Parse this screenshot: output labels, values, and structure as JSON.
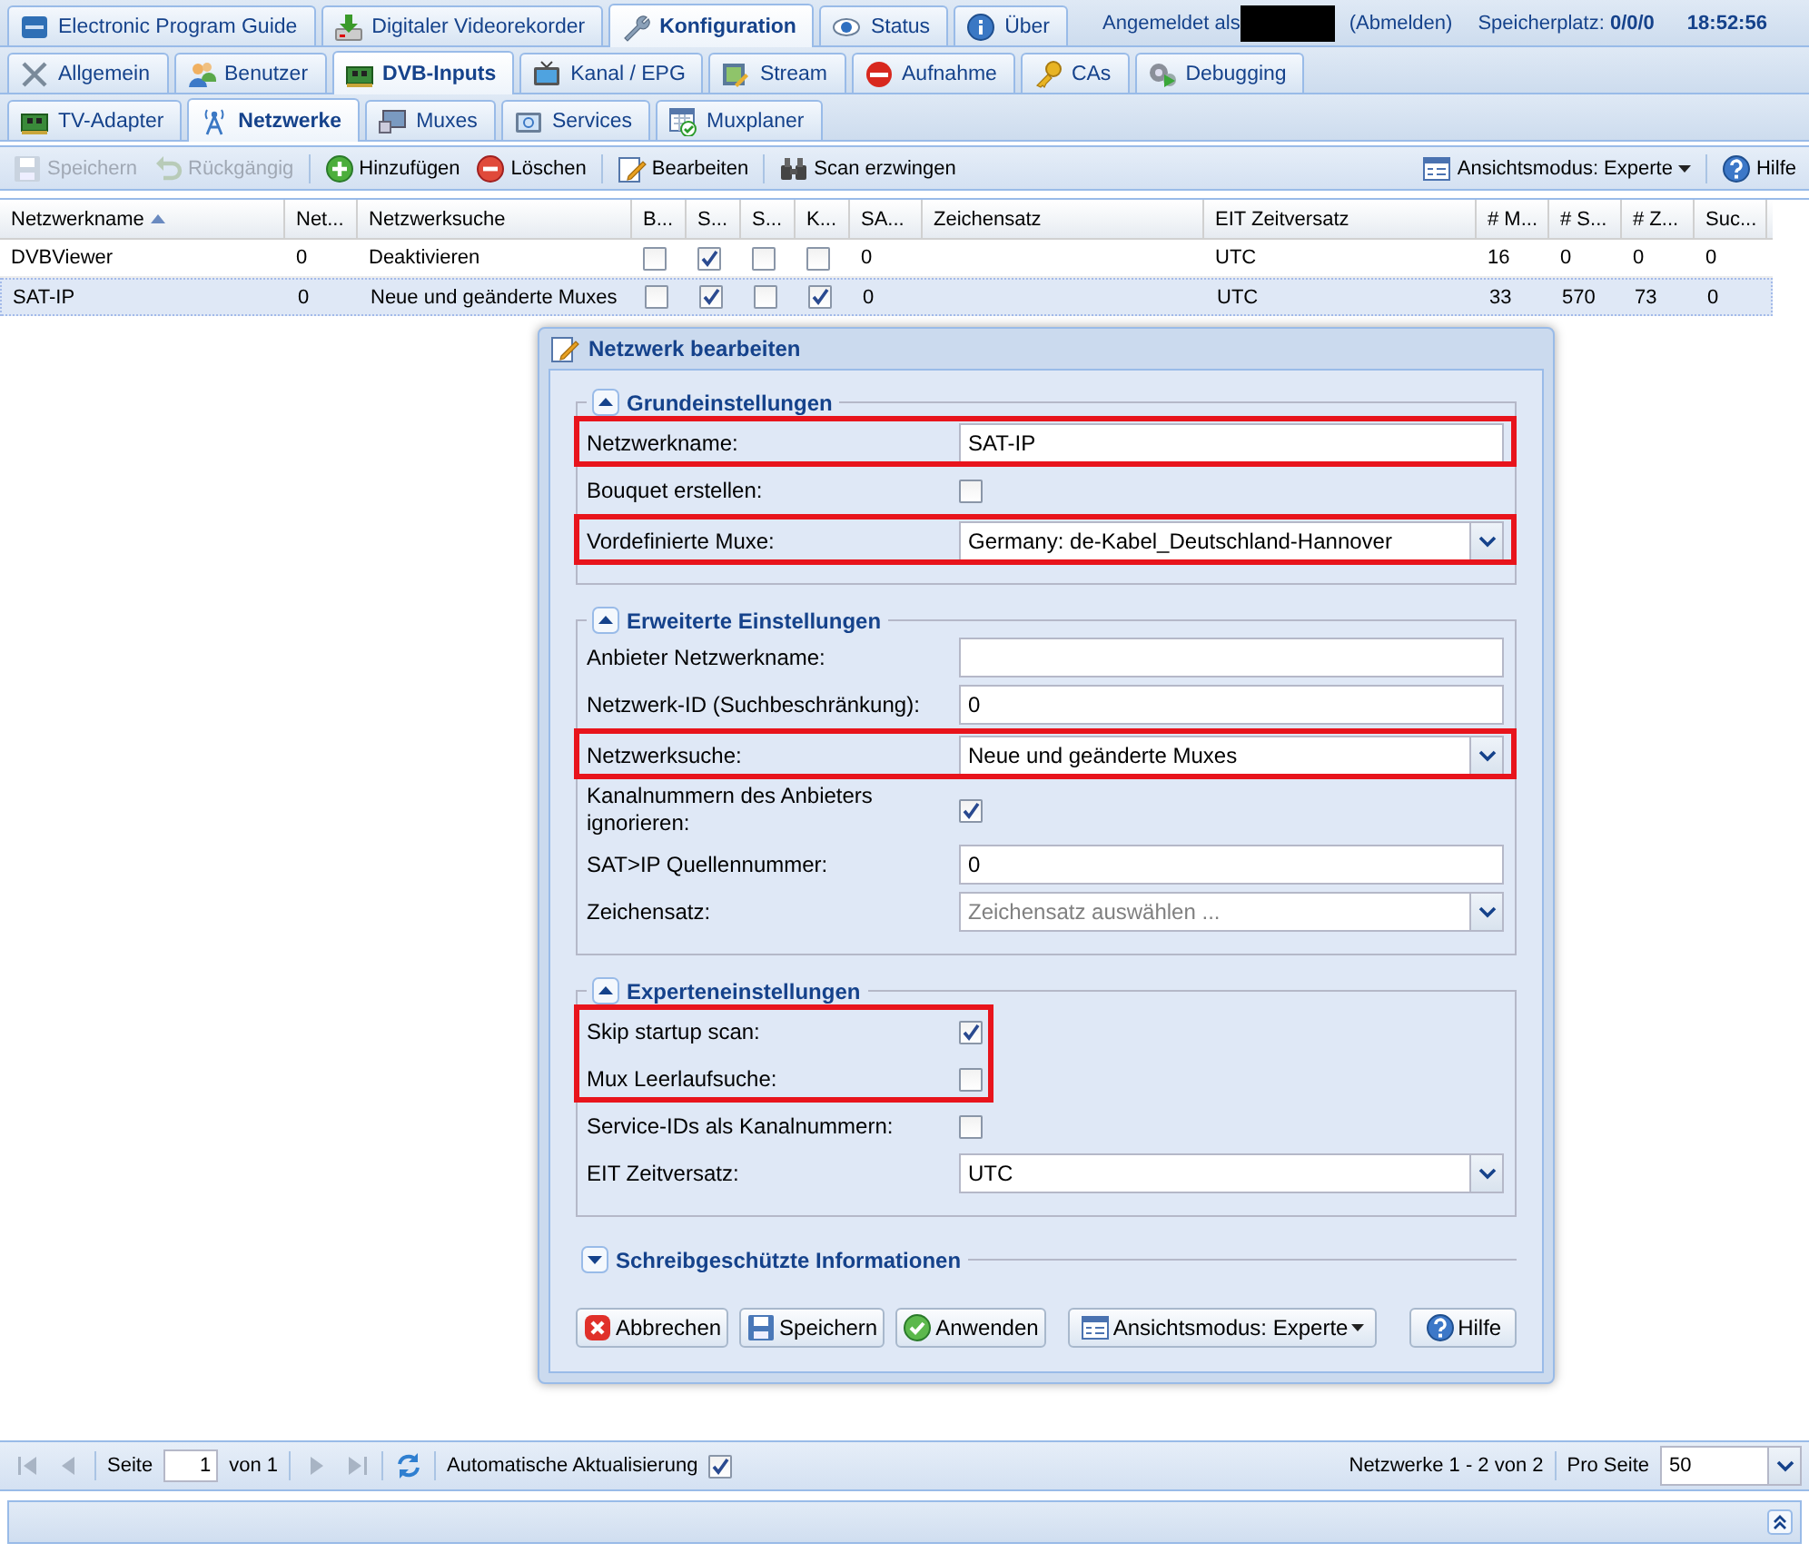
{
  "top_tabs": [
    {
      "label": "Electronic Program Guide",
      "selected": false
    },
    {
      "label": "Digitaler Videorekorder",
      "selected": false
    },
    {
      "label": "Konfiguration",
      "selected": true
    },
    {
      "label": "Status",
      "selected": false
    },
    {
      "label": "Über",
      "selected": false
    }
  ],
  "header": {
    "login_label": "Angemeldet als",
    "logout": "(Abmelden)",
    "storage": "Speicherplatz: **0/0/0**",
    "time": "18:52:56"
  },
  "sub_tabs": [
    {
      "label": "Allgemein",
      "selected": false
    },
    {
      "label": "Benutzer",
      "selected": false
    },
    {
      "label": "DVB-Inputs",
      "selected": true
    },
    {
      "label": "Kanal / EPG",
      "selected": false
    },
    {
      "label": "Stream",
      "selected": false
    },
    {
      "label": "Aufnahme",
      "selected": false
    },
    {
      "label": "CAs",
      "selected": false
    },
    {
      "label": "Debugging",
      "selected": false
    }
  ],
  "third_tabs": [
    {
      "label": "TV-Adapter",
      "selected": false
    },
    {
      "label": "Netzwerke",
      "selected": true
    },
    {
      "label": "Muxes",
      "selected": false
    },
    {
      "label": "Services",
      "selected": false
    },
    {
      "label": "Muxplaner",
      "selected": false
    }
  ],
  "toolbar": {
    "items": [
      {
        "label": "Speichern",
        "disabled": true
      },
      {
        "label": "Rückgängig",
        "disabled": true
      },
      {
        "label": "Hinzufügen",
        "disabled": false
      },
      {
        "label": "Löschen",
        "disabled": false
      },
      {
        "label": "Bearbeiten",
        "disabled": false
      },
      {
        "label": "Scan erzwingen",
        "disabled": false
      }
    ],
    "view_mode": "Ansichtsmodus: Experte",
    "help": "Hilfe"
  },
  "table": {
    "columns": [
      {
        "label": "Netzwerkname",
        "kind": "text",
        "sorted": true
      },
      {
        "label": "Net...",
        "kind": "text",
        "sorted": false
      },
      {
        "label": "Netzwerksuche",
        "kind": "text",
        "sorted": false
      },
      {
        "label": "B...",
        "kind": "check",
        "sorted": false
      },
      {
        "label": "S...",
        "kind": "check",
        "sorted": false
      },
      {
        "label": "S...",
        "kind": "check",
        "sorted": false
      },
      {
        "label": "K...",
        "kind": "check",
        "sorted": false
      },
      {
        "label": "SA...",
        "kind": "text",
        "sorted": false
      },
      {
        "label": "Zeichensatz",
        "kind": "text",
        "sorted": false
      },
      {
        "label": "EIT Zeitversatz",
        "kind": "text",
        "sorted": false
      },
      {
        "label": "# M...",
        "kind": "text",
        "sorted": false
      },
      {
        "label": "# S...",
        "kind": "text",
        "sorted": false
      },
      {
        "label": "# Z...",
        "kind": "text",
        "sorted": false
      },
      {
        "label": "Suc...",
        "kind": "text",
        "sorted": false
      }
    ],
    "rows": [
      {
        "selected": false,
        "cells": [
          "DVBViewer",
          "0",
          "Deaktivieren",
          {
            "checked": false
          },
          {
            "checked": true
          },
          {
            "checked": false
          },
          {
            "checked": false
          },
          "0",
          null,
          "UTC",
          "16",
          "0",
          "0",
          "0"
        ]
      },
      {
        "selected": true,
        "cells": [
          "SAT-IP",
          "0",
          "Neue und geänderte Muxes",
          {
            "checked": false
          },
          {
            "checked": true
          },
          {
            "checked": false
          },
          {
            "checked": true
          },
          "0",
          null,
          "UTC",
          "33",
          "570",
          "73",
          "0"
        ]
      }
    ]
  },
  "dialog": {
    "title": "Netzwerk bearbeiten",
    "sections": [
      {
        "title": "Grundeinstellungen",
        "expanded": true,
        "rows": [
          {
            "label": "Netzwerkname:",
            "kind": "text",
            "value": "SAT-IP",
            "highlighted": true
          },
          {
            "label": "Bouquet erstellen:",
            "kind": "check",
            "checked": false,
            "highlighted": false
          },
          {
            "label": "Vordefinierte Muxe:",
            "kind": "select",
            "value": "Germany: de-Kabel_Deutschland-Hannover",
            "highlighted": true
          }
        ]
      },
      {
        "title": "Erweiterte Einstellungen",
        "expanded": true,
        "rows": [
          {
            "label": "Anbieter Netzwerkname:",
            "kind": "text",
            "highlighted": false
          },
          {
            "label": "Netzwerk-ID (Suchbeschränkung):",
            "kind": "text",
            "value": "0",
            "highlighted": false
          },
          {
            "label": "Netzwerksuche:",
            "kind": "select",
            "value": "Neue und geänderte Muxes",
            "highlighted": true
          },
          {
            "label": "Kanalnummern des Anbieters ignorieren:",
            "kind": "check",
            "checked": true,
            "highlighted": false
          },
          {
            "label": "SAT>IP Quellennummer:",
            "kind": "text",
            "value": "0",
            "highlighted": false
          },
          {
            "label": "Zeichensatz:",
            "kind": "select",
            "placeholder": "Zeichensatz auswählen ...",
            "highlighted": false
          }
        ]
      },
      {
        "title": "Experteneinstellungen",
        "expanded": true,
        "rows": [
          {
            "label": "Skip startup scan:",
            "kind": "check",
            "checked": true,
            "highlighted": true
          },
          {
            "label": "Mux Leerlaufsuche:",
            "kind": "check",
            "checked": false,
            "highlighted": true
          },
          {
            "label": "Service-IDs als Kanalnummern:",
            "kind": "check",
            "checked": false,
            "highlighted": false
          },
          {
            "label": "EIT Zeitversatz:",
            "kind": "select",
            "value": "UTC",
            "highlighted": false
          }
        ]
      },
      {
        "title": "Schreibgeschützte Informationen",
        "expanded": false
      }
    ],
    "buttons": [
      "Abbrechen",
      "Speichern",
      "Anwenden"
    ],
    "view_mode": "Ansichtsmodus: Experte",
    "help": "Hilfe"
  },
  "pager": {
    "page_label": "Seite",
    "page": "1",
    "of": "von 1",
    "auto_refresh": "Automatische Aktualisierung",
    "auto_refresh_checked": true,
    "summary": "Netzwerke 1 - 2 von 2",
    "per_page_label": "Pro Seite",
    "per_page": "50"
  }
}
